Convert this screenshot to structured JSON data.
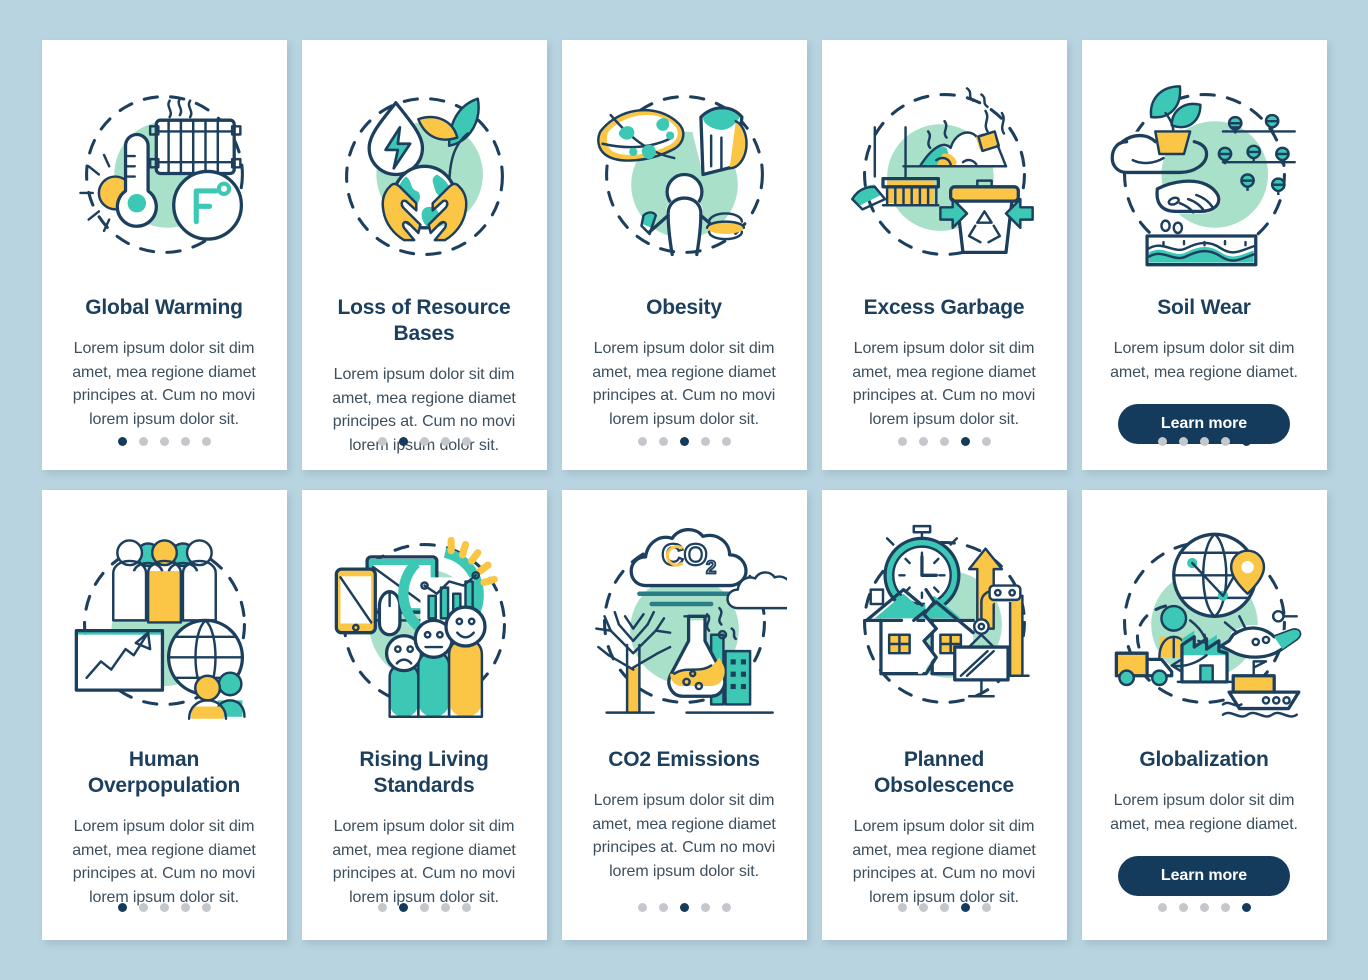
{
  "page": {
    "background_color": "#b8d4e0",
    "card_background": "#ffffff",
    "title_color": "#1d3f5e",
    "body_color": "#3d4f5c",
    "accent_button_color": "#143a5c",
    "dot_active_color": "#143a5c",
    "dot_inactive_color": "#c4c8cc",
    "illustration_blob_color": "#a9e0ca",
    "illustration_teal": "#3cc8b4",
    "illustration_yellow": "#fbc546",
    "total_dots": 5
  },
  "cards": [
    {
      "id": "global-warming",
      "icon": "thermometer-radiator-fahrenheit-icon",
      "title": "Global Warming",
      "body": "Lorem ipsum dolor sit dim amet, mea regione diamet principes at. Cum no movi lorem ipsum dolor sit.",
      "active_dot": 1,
      "cta": null
    },
    {
      "id": "loss-of-resource-bases",
      "icon": "water-drop-energy-earth-hands-leaf-icon",
      "title": "Loss of Resource Bases",
      "body": "Lorem ipsum dolor sit dim amet, mea regione diamet principes at. Cum no movi lorem ipsum dolor sit.",
      "active_dot": 2,
      "cta": null
    },
    {
      "id": "obesity",
      "icon": "pizza-fries-burger-person-icon",
      "title": "Obesity",
      "body": "Lorem ipsum dolor sit dim amet, mea regione diamet principes at. Cum no movi lorem ipsum dolor sit.",
      "active_dot": 3,
      "cta": null
    },
    {
      "id": "excess-garbage",
      "icon": "broom-trash-pile-recycle-bin-icon",
      "title": "Excess Garbage",
      "body": "Lorem ipsum dolor sit dim amet, mea regione diamet principes at. Cum no movi lorem ipsum dolor sit.",
      "active_dot": 4,
      "cta": null
    },
    {
      "id": "soil-wear",
      "icon": "hand-sprout-field-soil-layers-icon",
      "title": "Soil Wear",
      "body": "Lorem ipsum dolor sit dim amet, mea regione diamet.",
      "active_dot": 5,
      "cta": "Learn more"
    },
    {
      "id": "human-overpopulation",
      "icon": "crowd-growth-chart-globe-icon",
      "title": "Human Overpopulation",
      "body": "Lorem ipsum dolor sit dim amet, mea regione diamet principes at. Cum no movi lorem ipsum dolor sit.",
      "active_dot": 1,
      "cta": null
    },
    {
      "id": "rising-living-standards",
      "icon": "devices-analytics-satisfaction-faces-icon",
      "title": "Rising Living Standards",
      "body": "Lorem ipsum dolor sit dim amet, mea regione diamet principes at. Cum no movi lorem ipsum dolor sit.",
      "active_dot": 2,
      "cta": null
    },
    {
      "id": "co2-emissions",
      "icon": "co2-cloud-dead-tree-factory-flask-icon",
      "title": "CO2 Emissions",
      "body": "Lorem ipsum dolor sit dim amet, mea regione diamet principes at. Cum no movi lorem ipsum dolor sit.",
      "active_dot": 3,
      "cta": null
    },
    {
      "id": "planned-obsolescence",
      "icon": "clock-broken-house-crane-monitor-icon",
      "title": "Planned Obsolescence",
      "body": "Lorem ipsum dolor sit dim amet, mea regione diamet principes at. Cum no movi lorem ipsum dolor sit.",
      "active_dot": 4,
      "cta": null
    },
    {
      "id": "globalization",
      "icon": "globe-pin-truck-factory-plane-ship-icon",
      "title": "Globalization",
      "body": "Lorem ipsum dolor sit dim amet, mea regione diamet.",
      "active_dot": 5,
      "cta": "Learn more"
    }
  ]
}
